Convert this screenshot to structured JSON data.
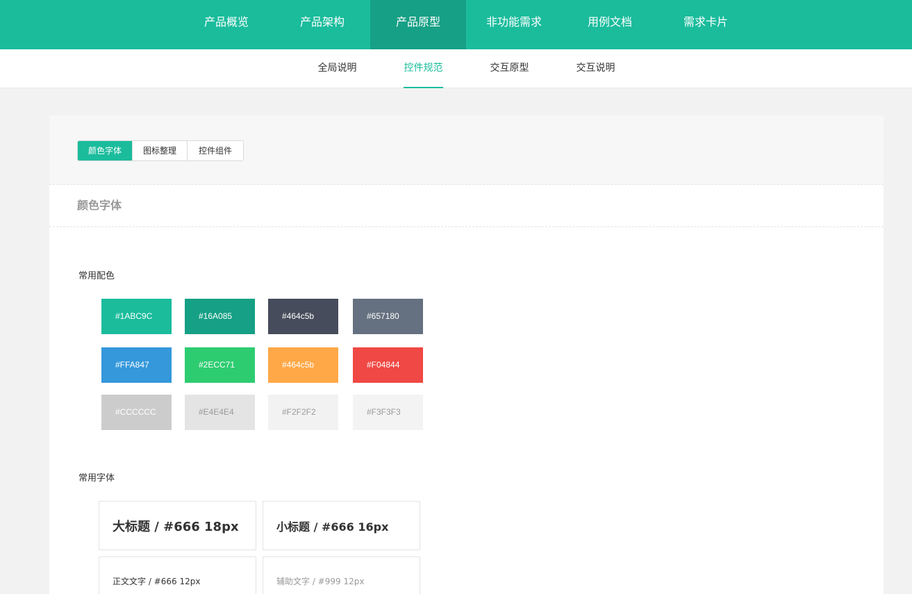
{
  "top_nav": {
    "items": [
      "产品概览",
      "产品架构",
      "产品原型",
      "非功能需求",
      "用例文档",
      "需求卡片"
    ],
    "active_index": 2
  },
  "sub_nav": {
    "items": [
      "全局说明",
      "控件规范",
      "交互原型",
      "交互说明"
    ],
    "active_index": 1
  },
  "tabs": {
    "items": [
      "颜色字体",
      "图标整理",
      "控件组件"
    ],
    "active_index": 0
  },
  "section_title": "颜色字体",
  "colors": {
    "label": "常用配色",
    "swatches": [
      {
        "text": "#1ABC9C",
        "bg": "#1abc9c",
        "fg": "#ffffff"
      },
      {
        "text": "#16A085",
        "bg": "#16a085",
        "fg": "#ffffff"
      },
      {
        "text": "#464c5b",
        "bg": "#464c5b",
        "fg": "#ffffff"
      },
      {
        "text": "#657180",
        "bg": "#657180",
        "fg": "#ffffff"
      },
      {
        "text": "#FFA847",
        "bg": "#3498db",
        "fg": "#ffffff"
      },
      {
        "text": "#2ECC71",
        "bg": "#2ecc71",
        "fg": "#ffffff"
      },
      {
        "text": "#464c5b",
        "bg": "#ffa847",
        "fg": "#ffffff"
      },
      {
        "text": "#F04844",
        "bg": "#f04844",
        "fg": "#ffffff"
      },
      {
        "text": "#CCCCCC",
        "bg": "#cccccc",
        "fg": "#ffffff"
      },
      {
        "text": "#E4E4E4",
        "bg": "#e4e4e4",
        "fg": "#999999"
      },
      {
        "text": "#F2F2F2",
        "bg": "#f2f2f2",
        "fg": "#999999"
      },
      {
        "text": "#F3F3F3",
        "bg": "#f3f3f3",
        "fg": "#999999"
      }
    ]
  },
  "fonts": {
    "label": "常用字体",
    "samples": [
      {
        "text": "大标题 / #666  18px",
        "color": "#333333",
        "weight": "bold",
        "size": "18px"
      },
      {
        "text": "小标题 / #666  16px",
        "color": "#333333",
        "weight": "bold",
        "size": "16px"
      },
      {
        "text": "正文文字 / #666  12px",
        "color": "#333333",
        "weight": "normal",
        "size": "12px"
      },
      {
        "text": "辅助文字 / #999  12px",
        "color": "#999999",
        "weight": "normal",
        "size": "12px"
      }
    ]
  }
}
